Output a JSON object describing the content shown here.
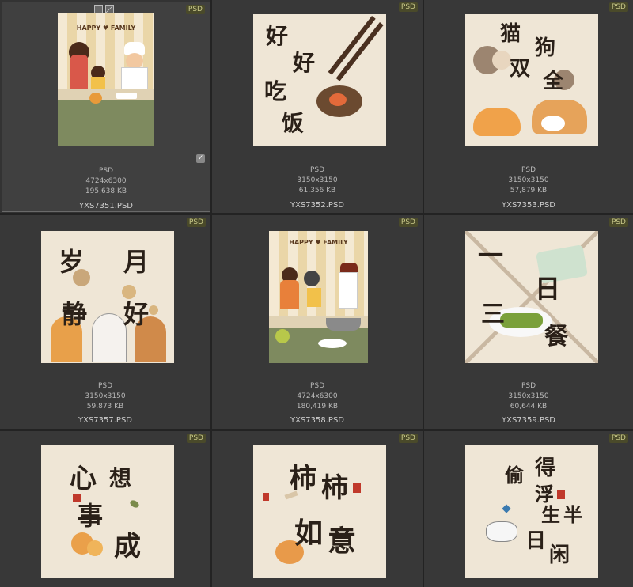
{
  "badge_label": "PSD",
  "items": [
    {
      "type": "PSD",
      "dims": "4724x6300",
      "size": "195,638 KB",
      "name": "YXS7351.PSD",
      "art_title": "HAPPY ♥ FAMILY"
    },
    {
      "type": "PSD",
      "dims": "3150x3150",
      "size": "61,356 KB",
      "name": "YXS7352.PSD",
      "art_chars": [
        "好",
        "好",
        "吃",
        "饭"
      ]
    },
    {
      "type": "PSD",
      "dims": "3150x3150",
      "size": "57,879 KB",
      "name": "YXS7353.PSD",
      "art_chars": [
        "猫",
        "狗",
        "双",
        "全"
      ]
    },
    {
      "type": "PSD",
      "dims": "3150x3150",
      "size": "59,873 KB",
      "name": "YXS7357.PSD",
      "art_chars": [
        "岁",
        "月",
        "静",
        "好"
      ]
    },
    {
      "type": "PSD",
      "dims": "4724x6300",
      "size": "180,419 KB",
      "name": "YXS7358.PSD",
      "art_title": "HAPPY ♥ FAMILY"
    },
    {
      "type": "PSD",
      "dims": "3150x3150",
      "size": "60,644 KB",
      "name": "YXS7359.PSD",
      "art_chars": [
        "一",
        "日",
        "三",
        "餐"
      ]
    },
    {
      "art_chars": [
        "心",
        "想",
        "事",
        "成"
      ]
    },
    {
      "art_chars": [
        "柿",
        "柿",
        "如",
        "意"
      ]
    },
    {
      "art_chars": [
        "偷",
        "得",
        "浮",
        "生",
        "半",
        "日",
        "闲"
      ]
    }
  ],
  "colors": {
    "background": "#333333",
    "selected_border": "#6a6a6a",
    "badge_bg": "#4a4a2a",
    "badge_text": "#c9c98a",
    "paper": "#efe6d6"
  }
}
